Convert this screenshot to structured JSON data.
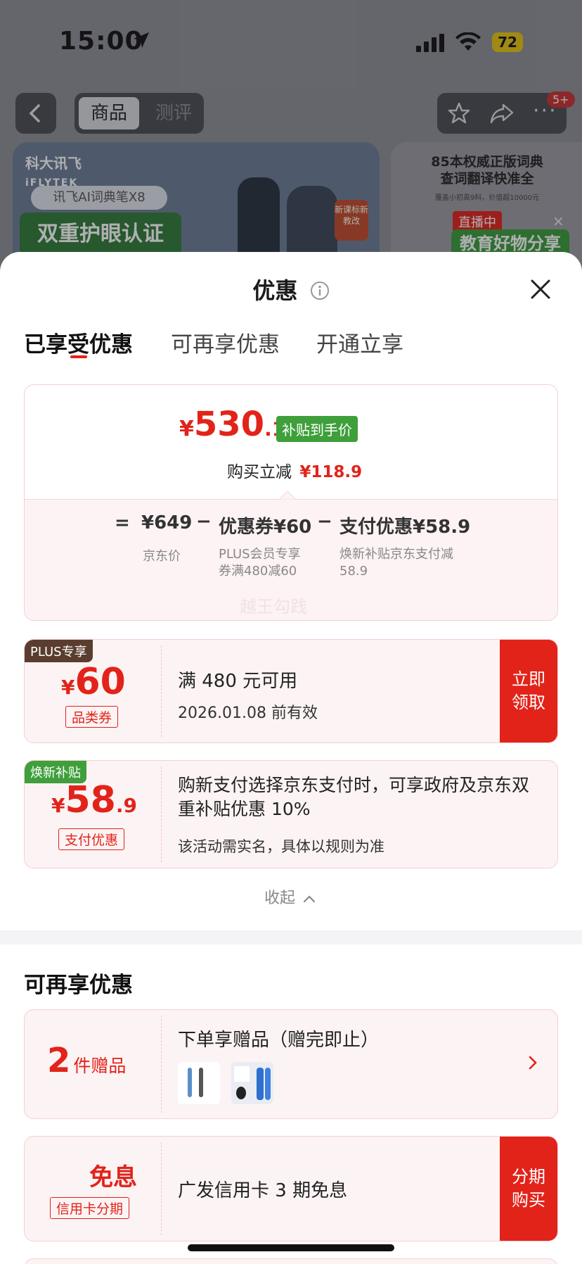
{
  "status_bar": {
    "time": "15:00",
    "battery": "72"
  },
  "product_header": {
    "tabs": [
      "商品",
      "测评"
    ],
    "cart_badge": "5+"
  },
  "banner": {
    "brand": "科大讯飞",
    "brand_en": "iFLYTEK",
    "product_name": "讯飞AI词典笔X8",
    "slogan": "双重护眼认证",
    "stamp": "新课标新教改",
    "right_title_1": "85本权威正版词典",
    "right_title_2": "查词翻译快准全",
    "right_sub": "覆盖小初高9科，价值超10000元",
    "live_tag": "直播中",
    "live_text": "教育好物分享"
  },
  "sheet": {
    "title": "优惠",
    "tabs": [
      "已享受优惠",
      "可再享优惠",
      "开通立享"
    ],
    "summary": {
      "currency": "¥",
      "price_int": "530",
      "price_dec": ".1",
      "tag": "补贴到手价",
      "reduce_label": "购买立减",
      "reduce_value": "¥118.9",
      "formula": {
        "eq": "=",
        "base_value": "¥649",
        "base_label": "京东价",
        "minus": "−",
        "coupon_value": "优惠券¥60",
        "coupon_label": "PLUS会员专享券满480减60",
        "pay_value": "支付优惠¥58.9",
        "pay_label": "焕新补贴京东支付减58.9"
      },
      "watermark": "越王勾践"
    },
    "coupon_plus": {
      "corner": "PLUS专享",
      "currency": "¥",
      "amount": "60",
      "type": "品类券",
      "condition": "满 480 元可用",
      "expiry": "2026.01.08 前有效",
      "button": "立即领取"
    },
    "coupon_pay": {
      "corner": "焕新补贴",
      "currency": "¥",
      "amount": "58",
      "amount_dec": ".9",
      "type": "支付优惠",
      "desc": "购新支付选择京东支付时，可享政府及京东双重补贴优惠 10%",
      "note": "该活动需实名，具体以规则为准"
    },
    "collapse": "收起",
    "more_section": {
      "title": "可再享优惠",
      "gift": {
        "count": "2",
        "unit": "件赠品",
        "desc": "下单享赠品（赠完即止）"
      },
      "installment": {
        "title": "免息",
        "type": "信用卡分期",
        "desc": "广发信用卡 3 期免息",
        "button": "分期购买"
      }
    }
  },
  "colors": {
    "accent": "#e2231a",
    "subsidy_green": "#3f9f3b",
    "plus_brown": "#5a3d2e"
  }
}
